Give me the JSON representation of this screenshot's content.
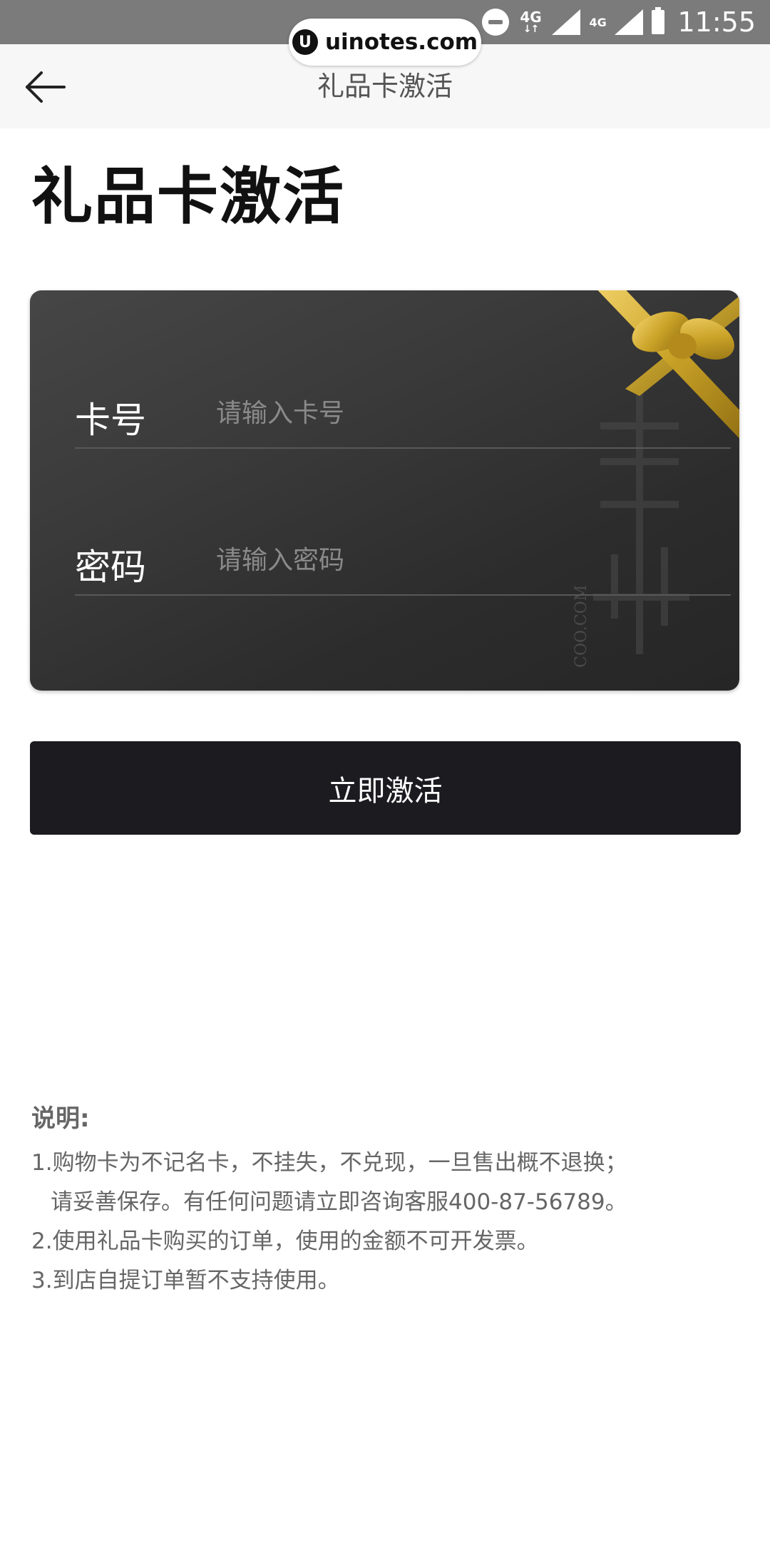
{
  "status_bar": {
    "network_1": "4G",
    "network_2": "4G",
    "time": "11:55"
  },
  "watermark": {
    "logo": "U",
    "text": "uinotes.com"
  },
  "nav": {
    "back_icon": "arrow-left-icon",
    "title": "礼品卡激活"
  },
  "page": {
    "title": "礼品卡激活"
  },
  "card": {
    "card_no_label": "卡号",
    "card_no_placeholder": "请输入卡号",
    "card_no_value": "",
    "password_label": "密码",
    "password_placeholder": "请输入密码",
    "password_value": "",
    "watermark_text": "SECOO.COM",
    "decoration_icon": "gold-bow-icon"
  },
  "activate_button": {
    "label": "立即激活"
  },
  "notes": {
    "title": "说明:",
    "lines": [
      "1.购物卡为不记名卡，不挂失，不兑现，一旦售出概不退换；",
      "请妥善保存。有任何问题请立即咨询客服400-87-56789。",
      "2.使用礼品卡购买的订单，使用的金额不可开发票。",
      "3.到店自提订单暂不支持使用。"
    ]
  },
  "colors": {
    "status_bar": "#7b7b7b",
    "nav_bar": "#f7f7f7",
    "card_dark": "#333333",
    "button": "#1c1b20",
    "gold": "#c9a227",
    "note_text": "#666666"
  }
}
